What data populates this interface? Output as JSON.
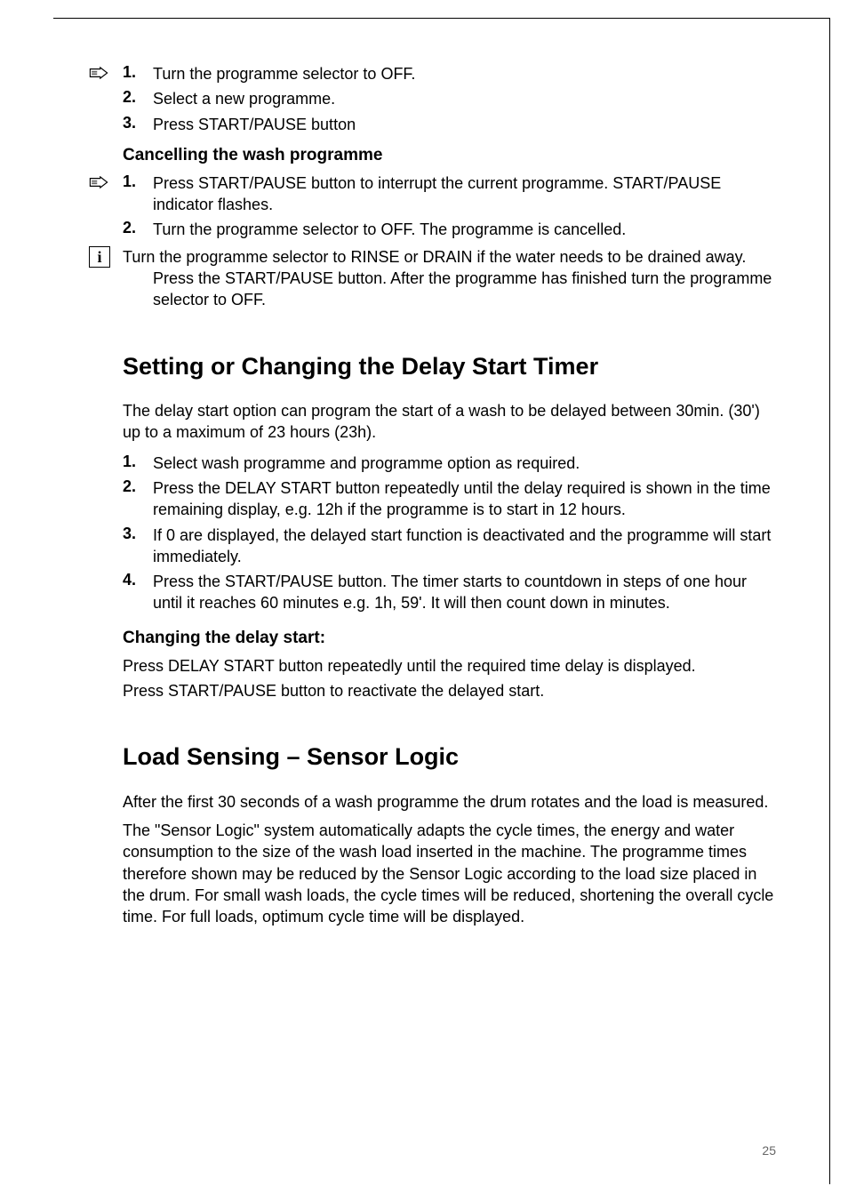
{
  "section1": {
    "items": [
      {
        "num": "1.",
        "text": "Turn the programme selector to OFF.",
        "icon": "hand"
      },
      {
        "num": "2.",
        "text": "Select a new programme.",
        "icon": ""
      },
      {
        "num": "3.",
        "text": "Press START/PAUSE button",
        "icon": ""
      }
    ]
  },
  "cancel": {
    "heading": "Cancelling the wash programme",
    "items": [
      {
        "num": "1.",
        "text": "Press START/PAUSE button to interrupt the current programme. START/PAUSE indicator flashes.",
        "icon": "hand"
      },
      {
        "num": "2.",
        "text": "Turn the programme selector to OFF. The programme is cancelled.",
        "icon": ""
      }
    ]
  },
  "info_note": "Turn the programme selector to RINSE or DRAIN if the water needs to be drained away. Press the START/PAUSE button. After the programme has finished turn the programme selector to OFF.",
  "delay": {
    "heading": "Setting or Changing the Delay Start Timer",
    "intro": "The delay start option can program the start of a wash to be delayed between 30min. (30') up to a maximum of 23 hours (23h).",
    "items": [
      {
        "num": "1.",
        "text": "Select wash programme and programme option as required."
      },
      {
        "num": "2.",
        "text": "Press the DELAY START button repeatedly until the delay required is shown in the time remaining display, e.g. 12h if the programme is to start in 12 hours."
      },
      {
        "num": "3.",
        "text": "If 0 are displayed, the delayed start function is deactivated and the programme will start immediately."
      },
      {
        "num": "4.",
        "text": "Press the START/PAUSE button. The timer starts to countdown in steps of one hour until it reaches 60 minutes e.g. 1h, 59'. It will then count down in minutes."
      }
    ],
    "change_heading": "Changing the delay start:",
    "change_items": [
      "Press DELAY START button repeatedly until the required time delay is displayed.",
      "Press START/PAUSE button to reactivate the delayed start."
    ]
  },
  "sensing": {
    "heading": "Load Sensing – Sensor Logic",
    "paras": [
      "After the first 30 seconds of a wash programme the drum rotates and the load is measured.",
      "The \"Sensor Logic\" system automatically adapts the cycle times, the energy and water consumption to the size of the wash load inserted in the machine. The programme times therefore shown may be reduced by the Sensor Logic according to the load size placed in the drum. For small wash loads, the cycle times will be reduced, shortening the overall cycle time. For full loads, optimum cycle time will be displayed."
    ]
  },
  "page_number": "25"
}
